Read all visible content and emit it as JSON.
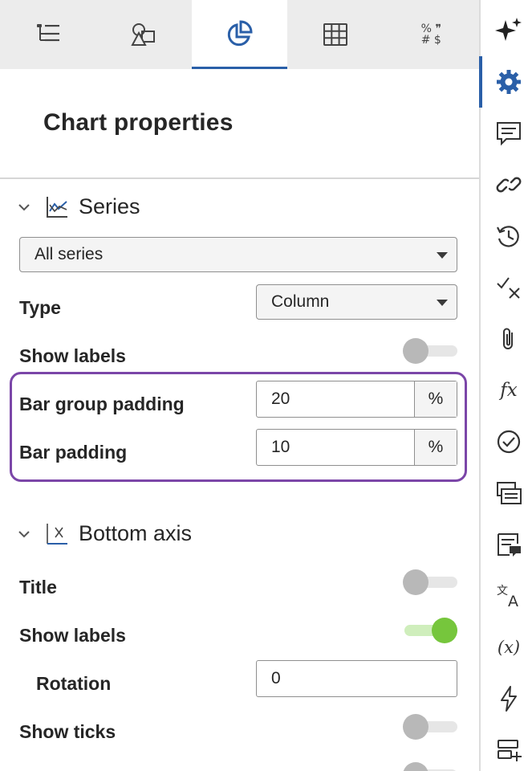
{
  "tabs": [
    {
      "icon": "list-tree-icon"
    },
    {
      "icon": "shapes-icon"
    },
    {
      "icon": "pie-chart-icon",
      "active": true
    },
    {
      "icon": "grid-table-icon"
    },
    {
      "icon": "number-format-icon",
      "glyph_top": "% ❞",
      "glyph_bottom": "# $"
    }
  ],
  "panel": {
    "title": "Chart properties",
    "series_section": {
      "title": "Series",
      "series_select": "All series",
      "type_label": "Type",
      "type_value": "Column",
      "show_labels_label": "Show labels",
      "show_labels_on": false,
      "bar_group_padding_label": "Bar group padding",
      "bar_group_padding_value": "20",
      "bar_group_padding_unit": "%",
      "bar_padding_label": "Bar padding",
      "bar_padding_value": "10",
      "bar_padding_unit": "%"
    },
    "bottom_axis_section": {
      "title": "Bottom axis",
      "title_label": "Title",
      "title_on": false,
      "show_labels_label": "Show labels",
      "show_labels_on": true,
      "rotation_label": "Rotation",
      "rotation_value": "0",
      "show_ticks_label": "Show ticks",
      "show_ticks_on": false
    }
  },
  "rail": {
    "active_index": 1,
    "icons": [
      "sparkle-ai-icon",
      "gear-icon",
      "comment-icon",
      "link-icon",
      "history-icon",
      "check-x-icon",
      "paperclip-icon",
      "function-fx-icon",
      "check-circle-icon",
      "cards-icon",
      "note-icon",
      "translate-icon",
      "variable-x-icon",
      "lightning-icon",
      "add-row-icon"
    ],
    "fx_glyph": "fx",
    "var_glyph": "(x)",
    "translate_glyph_top": "文",
    "translate_glyph_bottom": "A"
  },
  "colors": {
    "accent_blue": "#2a5fa8",
    "highlight_purple": "#7b46a8",
    "toggle_on": "#76c63c",
    "toggle_off": "#b8b8b8"
  }
}
